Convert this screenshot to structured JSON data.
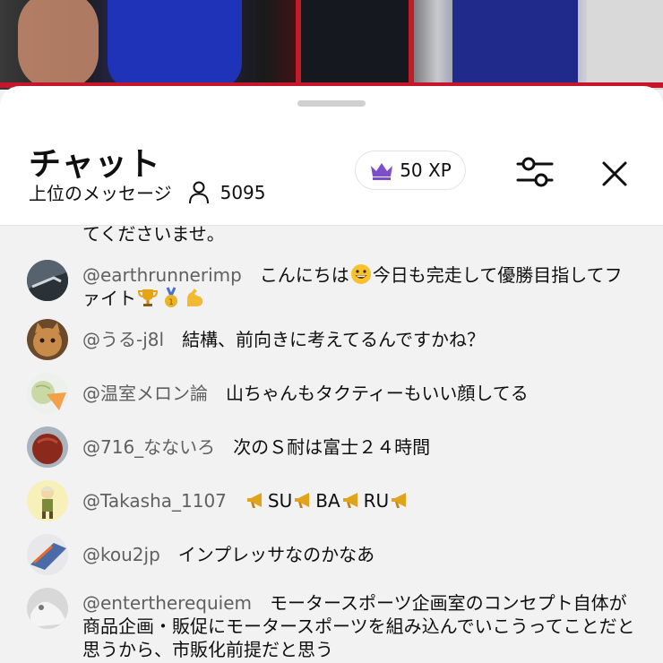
{
  "header": {
    "title": "チャット",
    "subtitle": "上位のメッセージ",
    "viewer_count": "5095",
    "xp": "50 XP"
  },
  "icons": {
    "xp": "crown-icon",
    "viewers": "person-icon",
    "filter": "sliders-icon",
    "close": "close-icon"
  },
  "colors": {
    "accent_purple": "#7c4dcc",
    "text_primary": "#0f0f0f",
    "author_gray": "#606060",
    "chat_bg": "#f2f2f2"
  },
  "messages": [
    {
      "author": "",
      "text": "てくださいませ。"
    },
    {
      "author": "@earthrunnerimp",
      "text_before": "こんにちは",
      "text_after": "今日も完走して優勝目指してファイト",
      "emojis": [
        "grinning-face",
        "trophy",
        "medal",
        "flexed-biceps"
      ]
    },
    {
      "author": "@うる-j8l",
      "text": "結構、前向きに考えてるんですかね？"
    },
    {
      "author": "@温室メロン論",
      "text": "山ちゃんもタクティーもいい顔してる"
    },
    {
      "author": "@716_なないろ",
      "text": "次のＳ耐は富士２４時間"
    },
    {
      "author": "@Takasha_1107",
      "parts": [
        "SU",
        "BA",
        "RU"
      ],
      "emoji": "megaphone"
    },
    {
      "author": "@kou2jp",
      "text": "インプレッサなのかなあ"
    },
    {
      "author": "@entertherequiem",
      "text": "モータースポーツ企画室のコンセプト自体が商品企画・販促にモータースポーツを組み込んでいこうってことだと思うから、市販化前提だと思う"
    }
  ]
}
